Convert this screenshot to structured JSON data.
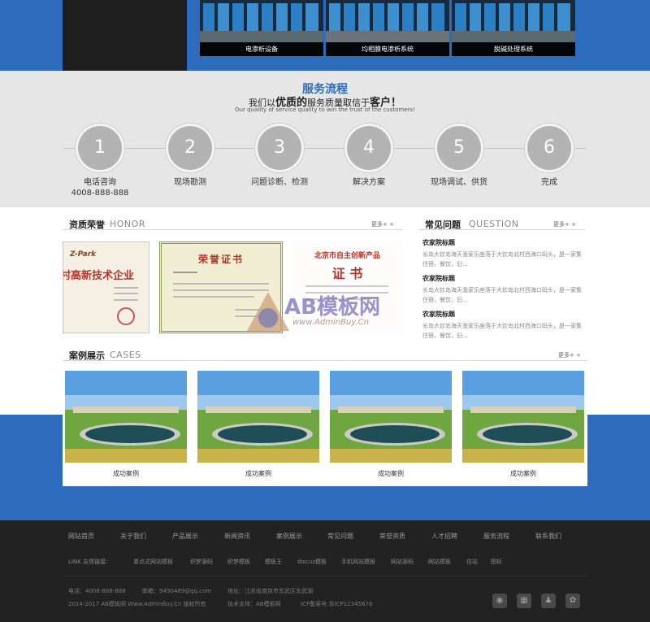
{
  "products": [
    {
      "caption": "电渗析设备"
    },
    {
      "caption": "均相膜电渗析系统"
    },
    {
      "caption": "脱碱处理系统"
    }
  ],
  "process": {
    "title": "服务流程",
    "sub_pre": "我们以",
    "sub_em1": "优质的",
    "sub_mid": "服务质量取信于",
    "sub_em2": "客户！",
    "en": "Our quality of service quality to win the trust of the customers!",
    "steps": [
      {
        "num": "1",
        "label": "电话咨询",
        "extra": "4008-888-888"
      },
      {
        "num": "2",
        "label": "现场勘测",
        "extra": ""
      },
      {
        "num": "3",
        "label": "问题诊断、检测",
        "extra": ""
      },
      {
        "num": "4",
        "label": "解决方案",
        "extra": ""
      },
      {
        "num": "5",
        "label": "现场调试、供货",
        "extra": ""
      },
      {
        "num": "6",
        "label": "完成",
        "extra": ""
      }
    ]
  },
  "honor": {
    "cn": "资质荣誉",
    "en": "HONOR",
    "more": "更多+ +"
  },
  "certs": {
    "c1_logo": "Z-Park",
    "c1_text": "村高新技术企业",
    "c2_title": "荣誉证书",
    "c3_title": "北京市自主创新产品",
    "c3_sub": "证  书"
  },
  "question": {
    "cn": "常见问题",
    "en": "QUESTION",
    "more": "更多+ +",
    "items": [
      {
        "title": "农家院标题",
        "desc": "长岛大钦岛海天渔家乐座落于大钦岛北村西海口码头，是一家集住宿，餐饮，旧..."
      },
      {
        "title": "农家院标题",
        "desc": "长岛大钦岛海天渔家乐座落于大钦岛北村西海口码头，是一家集住宿，餐饮，旧..."
      },
      {
        "title": "农家院标题",
        "desc": "长岛大钦岛海天渔家乐座落于大钦岛北村西海口码头，是一家集住宿，餐饮，旧..."
      }
    ]
  },
  "cases": {
    "cn": "案例展示",
    "en": "CASES",
    "more": "更多+ +",
    "items": [
      {
        "caption": "成功案例"
      },
      {
        "caption": "成功案例"
      },
      {
        "caption": "成功案例"
      },
      {
        "caption": "成功案例"
      }
    ]
  },
  "watermark": {
    "main": "AB模板网",
    "url": "www.AdminBuy.Cn"
  },
  "footer": {
    "nav": [
      "网站首页",
      "关于我们",
      "产品展示",
      "新闻资讯",
      "案例展示",
      "常见问题",
      "荣誉资质",
      "人才招聘",
      "服务流程",
      "联系我们"
    ],
    "links_label": "LINK 友情链接：",
    "links": [
      "单点式网站模板",
      "织梦源码",
      "织梦模板",
      "模板王",
      "discuz模板",
      "手机网站模板",
      "网站源码",
      "网站模板",
      "仿站",
      "图标"
    ],
    "phone": "电话：4008-888-888",
    "email": "邮箱：9490489@qq.com",
    "address": "地址：江苏省南京市玄武区玄武湖",
    "copyright": "2014-2017 AB模板网 Www.AdminBuy.Cn 版权所有",
    "support": "技术支持：AB模板网",
    "icp": "ICP备案号:苏ICP12345678",
    "social_icons": [
      "weibo-icon",
      "qr-code-icon",
      "qq-icon",
      "paw-icon"
    ]
  },
  "colors": {
    "brand_blue": "#2d6bbd",
    "dark": "#222222",
    "light_gray": "#e6e6e6"
  }
}
